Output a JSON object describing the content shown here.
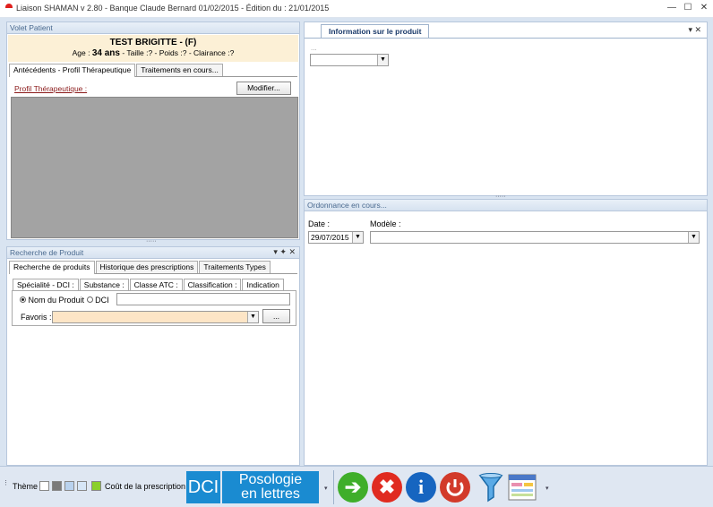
{
  "window": {
    "title": "Liaison SHAMAN v 2.80 - Banque Claude Bernard 01/02/2015 - Édition du : 21/01/2015",
    "min": "—",
    "max": "☐",
    "close": "✕"
  },
  "patient_panel": {
    "caption": "Volet Patient",
    "name": "TEST BRIGITTE - (F)",
    "age_label": "Age : ",
    "age_value": "34 ans",
    "info_rest": " - Taille :? - Poids :? - Clairance :?",
    "tabs": [
      "Antécédents - Profil Thérapeutique",
      "Traitements en cours..."
    ],
    "profil_link": "Profil Thérapeutique :",
    "modifier_button": "Modifier..."
  },
  "search_panel": {
    "caption": "Recherche de Produit",
    "caption_icons": "▾ ✦ ✕",
    "tabs": [
      "Recherche de produits",
      "Historique des prescriptions",
      "Traitements Types"
    ],
    "subtabs": [
      "Spécialité - DCI :",
      "Substance :",
      "Classe ATC :",
      "Classification :",
      "Indication"
    ],
    "radio_nom": "Nom du Produit",
    "radio_dci": "DCI",
    "favoris_label": "Favoris :",
    "favoris_button": "..."
  },
  "info_panel": {
    "tab": "Information sur le produit",
    "dots": "...",
    "controls": "▾ ✕"
  },
  "ordonnance_panel": {
    "caption": "Ordonnance en cours...",
    "date_label": "Date :",
    "date_value": "29/07/2015",
    "modele_label": "Modèle :"
  },
  "toolbar": {
    "theme_label": "Thème :",
    "theme_colors": [
      "#ffffff",
      "#7a7a7a",
      "#b9d2ee",
      "#d7e6f6",
      "#8bd02b"
    ],
    "cout_label": "Coût de la prescription €",
    "dci_button": "DCI",
    "posologie_line1": "Posologie",
    "posologie_line2": "en lettres",
    "accent": "#1a8bd1",
    "arrow_glyph": "➔",
    "cancel_glyph": "✖",
    "info_glyph": "i"
  }
}
